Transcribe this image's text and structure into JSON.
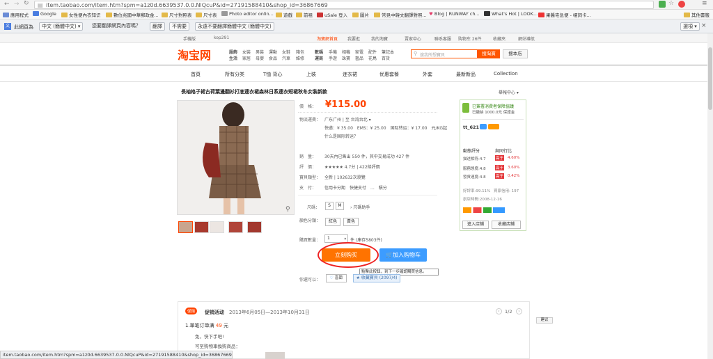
{
  "browser": {
    "url": "item.taobao.com/item.htm?spm=a1z0d.6639537.0.0.NlQcuP&id=27191588410&shop_id=36867669",
    "bookmarks": [
      "應用程式",
      "Google",
      "女性便內衣知识",
      "數位兆國中華郵政金...",
      "尺寸對照表",
      "尺寸表",
      "Photo editor onlin...",
      "遊戲",
      "前祖",
      "uSale 登入",
      "圖片",
      "常見中韓文翻譯對照...",
      "Blog | RUNWAY ch...",
      "What's Hot | LOOK...",
      "果醬宅急便 - 嗄詞卡...",
      "其他書籤"
    ],
    "translate": {
      "prefix": "此網頁為",
      "lang": "中文 (簡體中文)",
      "question": "您要翻譯網頁內容嗎？",
      "translate_btn": "翻譯",
      "no_btn": "不需要",
      "never_btn": "永遠不要翻譯簡體中文 (簡體中文)",
      "options_btn": "選項"
    },
    "status_url": "item.taobao.com/item.htm?spm=a1z0d.6639537.0.0.NlQcuP&id=27191588410&shop_id=36867669"
  },
  "taobao": {
    "top_left": [
      "手機版",
      "kop291"
    ],
    "top_right": [
      "淘寶網首頁",
      "我要逛",
      "我的淘寶",
      "賣家中心",
      "聯系客服",
      "购物车 26件",
      "收藏夾",
      "網站導航"
    ],
    "logo": "淘宝网",
    "categories": [
      [
        "服飾",
        "女裝",
        "男裝",
        "運動",
        "女鞋",
        "箱包",
        "數碼",
        "手機",
        "相機",
        "家電",
        "配件",
        "筆記本"
      ],
      [
        "生活",
        "家居",
        "母嬰",
        "食品",
        "汽車",
        "維修",
        "運商",
        "手遊",
        "珠寶",
        "藝品",
        "花鳥",
        "百貨"
      ]
    ],
    "search_placeholder": "搜我所想寶貝",
    "search_btn": "搜淘寶",
    "store_btn": "搜本店",
    "nav": [
      "首頁",
      "所有分类",
      "T恤 背心",
      "上裝",
      "连衣裙",
      "优惠套餐",
      "外套",
      "最新新品",
      "Collection"
    ]
  },
  "product": {
    "title": "長袖格子裙古荷葉邊翻衫打底連衣裙森林日系連衣短裙秋冬女裝新款",
    "report": "舉報中心",
    "price_label": "價　格：",
    "price": "¥115.00",
    "shipping_label": "物流運費：",
    "shipping_route": "广东广州 | 至 台湾台北",
    "shipping_fees": "快递：¥ 35.00　EMS：¥ 25.00　国际转运：¥ 17.00　元/KG起",
    "shipping_q": "什么是国际转运？",
    "sales_label": "銷　量：",
    "sales": "30天內已售出 550 件，其中交易成功 427 件",
    "rating_label": "評　價：",
    "rating": "★★★★★ 4.7分 | 422條評價",
    "points_label": "寶貝類型：",
    "points": "全新 | 102632次瀏覽",
    "pay_label": "支　付：",
    "pay": "信用卡分期　快捷支付　...　積分",
    "size_label": "尺碼：",
    "sizes": [
      "S",
      "M"
    ],
    "size_helper": "尺碼助手",
    "color_label": "顏色分類：",
    "colors": [
      "紅色",
      "黃色"
    ],
    "qty_label": "購買數量：",
    "qty": "1",
    "stock": "件 (庫存5803件)",
    "buy_btn": "立刻购买",
    "cart_btn": "加入购物车",
    "tip": "點擊此按鈕，到下一步確認購買信息。",
    "share_label": "你還可以：",
    "share_btn": "喜歡",
    "collect_btn": "收藏寶貝 (2097/4)"
  },
  "seller": {
    "guarantee": "已簽署消費者保障協議",
    "deposit": "已繳納 1000.0元 保證金",
    "name": "tt_621",
    "dsr_title": "動態評分",
    "dsr_compare": "與同行比",
    "dsr": [
      [
        "描述相符:4.7",
        "高于",
        "4.60%"
      ],
      [
        "服務態度:4.8",
        "高于",
        "3.60%"
      ],
      [
        "發貨速度:4.8",
        "高于",
        "0.42%"
      ]
    ],
    "good_rate": "好評率:99.11%",
    "credit": "買家信用: 197",
    "created": "創店時間:2008-12-16",
    "enter_btn": "進入店鋪",
    "collect_btn": "收藏店鋪"
  },
  "promo": {
    "badge": "促銷",
    "title": "促销活动",
    "date": "2013年6月05日—2013年10月31日",
    "page": "1/2",
    "item1_a": "1.單笔订单满 ",
    "item1_b": "49",
    "item1_c": " 元",
    "item2": "免，快下手吧!",
    "item3": "可至购物車換购商品：",
    "feedback": "建议"
  },
  "colors": {
    "accent": "#ff4400",
    "buy": "#ff7300",
    "cart": "#3c9cff",
    "circle": "#e22222"
  }
}
